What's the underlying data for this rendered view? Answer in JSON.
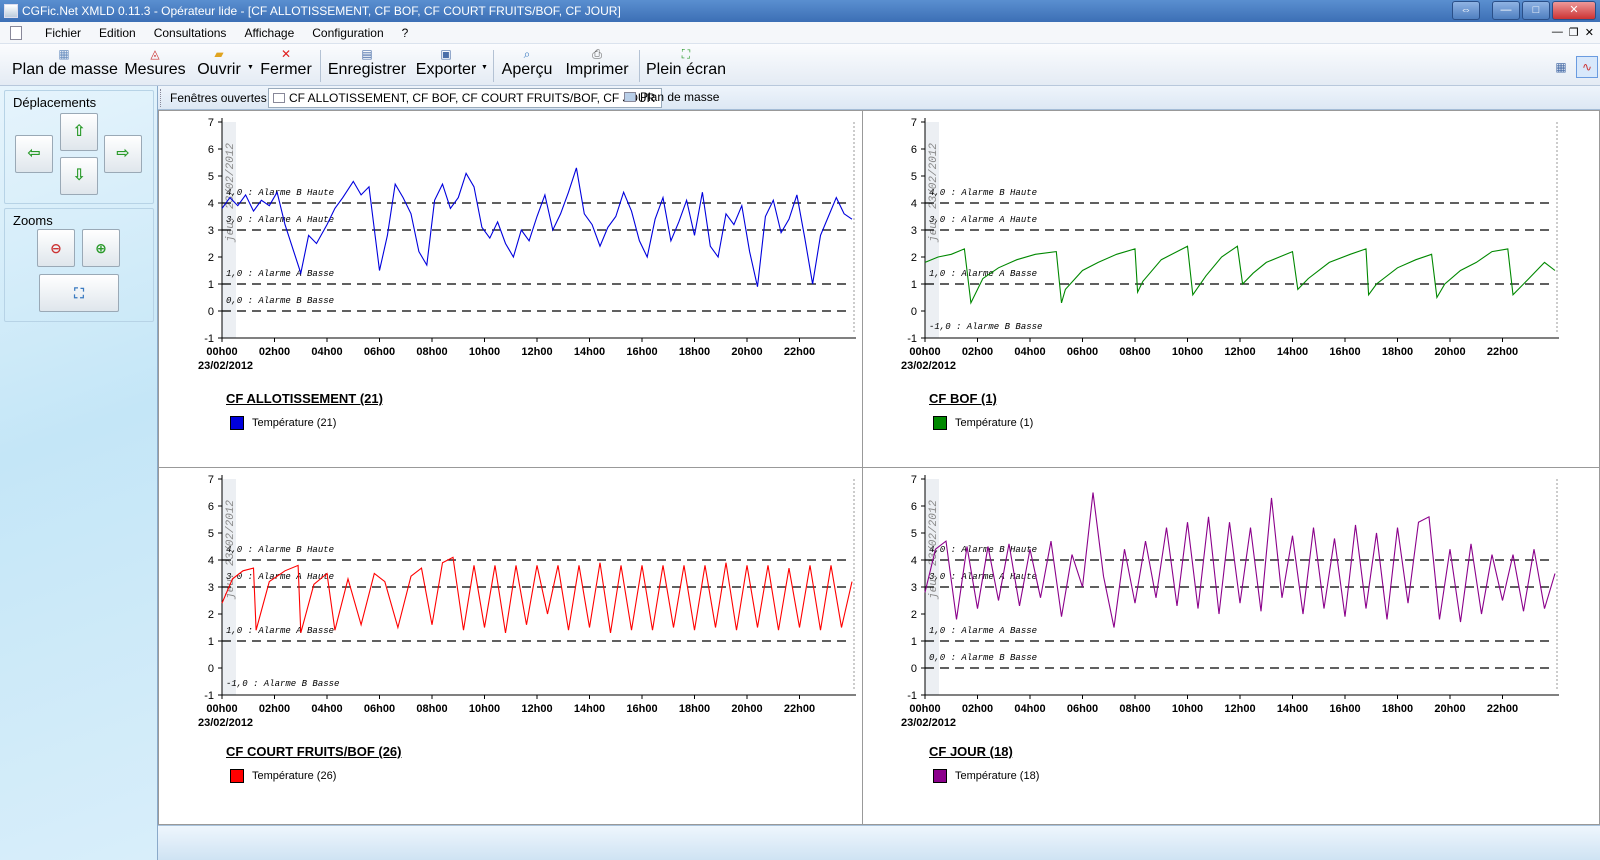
{
  "window": {
    "title": "CGFic.Net XMLD 0.11.3 - Opérateur lide - [CF ALLOTISSEMENT, CF BOF, CF COURT FRUITS/BOF, CF JOUR]",
    "buttons": [
      "⇔",
      "—",
      "□",
      "✕"
    ]
  },
  "menu": {
    "items": [
      "Fichier",
      "Edition",
      "Consultations",
      "Affichage",
      "Configuration",
      "?"
    ],
    "mdi_controls": [
      "—",
      "❐",
      "✕"
    ]
  },
  "toolbar": {
    "buttons": [
      {
        "label": "Plan de masse",
        "icon": "site-plan-icon"
      },
      {
        "label": "Mesures",
        "icon": "measures-chart-icon"
      },
      {
        "label": "Ouvrir",
        "icon": "folder-open-icon"
      },
      {
        "label": "Fermer",
        "icon": "close-x-icon"
      },
      {
        "label": "Enregistrer",
        "icon": "save-icon"
      },
      {
        "label": "Exporter",
        "icon": "export-icon"
      },
      {
        "label": "Aperçu",
        "icon": "preview-magnifier-icon"
      },
      {
        "label": "Imprimer",
        "icon": "printer-icon"
      },
      {
        "label": "Plein écran",
        "icon": "fullscreen-icon"
      }
    ],
    "dropdown_glyph": "▼",
    "right_buttons": [
      "table-view-icon",
      "chart-view-icon"
    ]
  },
  "left_panel": {
    "deplacements_title": "Déplacements",
    "zooms_title": "Zooms",
    "arrows": {
      "up": "⇧",
      "left": "⇦",
      "right": "⇨",
      "down": "⇩"
    },
    "zoom_buttons": [
      "zoom-out-icon",
      "zoom-in-icon",
      "zoom-fit-icon"
    ]
  },
  "tabs": {
    "label": "Fenêtres ouvertes :",
    "items": [
      {
        "label": "CF ALLOTISSEMENT, CF BOF, CF COURT FRUITS/BOF, CF JOUR",
        "active": true
      },
      {
        "label": "Plan de masse",
        "active": false
      }
    ]
  },
  "charts": {
    "y_ticks": [
      "7",
      "6",
      "5",
      "4",
      "3",
      "2",
      "1",
      "0",
      "-1"
    ],
    "x_ticks": [
      "00h00",
      "02h00",
      "04h00",
      "06h00",
      "08h00",
      "10h00",
      "12h00",
      "14h00",
      "16h00",
      "18h00",
      "20h00",
      "22h00"
    ],
    "date_label": "23/02/2012",
    "date_rotated": "jeu. 23/02/2012",
    "colors": {
      "axis": "#000000",
      "threshold": "#000000"
    }
  },
  "chart_data": [
    {
      "type": "line",
      "title": "CF ALLOTISSEMENT (21)",
      "xlabel": "",
      "ylabel": "",
      "ylim": [
        -1,
        7
      ],
      "xlim_hours": [
        0,
        24
      ],
      "thresholds": [
        {
          "value": 4.0,
          "label": "4,0 : Alarme B Haute"
        },
        {
          "value": 3.0,
          "label": "3,0 : Alarme A Haute"
        },
        {
          "value": 1.0,
          "label": "1,0 : Alarme A Basse"
        },
        {
          "value": 0.0,
          "label": "0,0 : Alarme B Basse"
        }
      ],
      "series": [
        {
          "name": "Température (21)",
          "color": "#0000dd",
          "x_hours": [
            0,
            0.3,
            0.6,
            0.9,
            1.2,
            1.5,
            1.8,
            2.1,
            2.4,
            2.7,
            3.0,
            3.3,
            3.6,
            4.0,
            4.3,
            4.6,
            5.0,
            5.3,
            5.6,
            6.0,
            6.3,
            6.6,
            6.9,
            7.2,
            7.5,
            7.8,
            8.1,
            8.4,
            8.7,
            9.0,
            9.3,
            9.6,
            9.9,
            10.2,
            10.5,
            10.8,
            11.1,
            11.4,
            11.7,
            12.0,
            12.3,
            12.6,
            12.9,
            13.2,
            13.5,
            13.8,
            14.1,
            14.4,
            14.7,
            15.0,
            15.3,
            15.6,
            15.9,
            16.2,
            16.5,
            16.8,
            17.1,
            17.4,
            17.7,
            18.0,
            18.3,
            18.6,
            18.9,
            19.2,
            19.5,
            19.8,
            20.1,
            20.4,
            20.7,
            21.0,
            21.3,
            21.6,
            21.9,
            22.2,
            22.5,
            22.8,
            23.1,
            23.4,
            23.7,
            24.0
          ],
          "values": [
            3.8,
            4.2,
            3.9,
            4.3,
            3.7,
            4.1,
            3.9,
            4.4,
            3.2,
            2.3,
            1.4,
            2.8,
            2.5,
            3.2,
            3.8,
            4.2,
            4.8,
            4.3,
            4.6,
            1.5,
            2.8,
            4.7,
            4.2,
            3.6,
            2.2,
            1.7,
            4.1,
            4.7,
            3.8,
            4.2,
            5.1,
            4.6,
            3.1,
            2.7,
            3.3,
            2.5,
            2.0,
            3.0,
            2.6,
            3.5,
            4.3,
            3.0,
            3.6,
            4.4,
            5.3,
            3.6,
            3.2,
            2.4,
            3.1,
            3.5,
            4.4,
            3.7,
            2.6,
            2.0,
            3.4,
            4.2,
            2.6,
            3.3,
            4.1,
            2.8,
            4.4,
            2.4,
            2.0,
            3.6,
            3.2,
            3.9,
            2.2,
            0.9,
            3.5,
            4.1,
            2.9,
            3.4,
            4.3,
            2.7,
            1.0,
            2.8,
            3.5,
            4.2,
            3.6,
            3.4
          ]
        }
      ]
    },
    {
      "type": "line",
      "title": "CF BOF (1)",
      "xlabel": "",
      "ylabel": "",
      "ylim": [
        -1,
        7
      ],
      "xlim_hours": [
        0,
        24
      ],
      "thresholds": [
        {
          "value": 4.0,
          "label": "4,0 : Alarme B Haute"
        },
        {
          "value": 3.0,
          "label": "3,0 : Alarme A Haute"
        },
        {
          "value": 1.0,
          "label": "1,0 : Alarme A Basse"
        },
        {
          "value": -1.0,
          "label": "-1,0 : Alarme B Basse"
        }
      ],
      "series": [
        {
          "name": "Température (1)",
          "color": "#008800",
          "x_hours": [
            0,
            0.5,
            1.0,
            1.5,
            1.75,
            2.2,
            2.8,
            3.5,
            4.2,
            5.0,
            5.2,
            5.35,
            6.0,
            6.6,
            7.3,
            8.0,
            8.1,
            8.3,
            9.0,
            9.6,
            10.0,
            10.2,
            10.7,
            11.3,
            11.9,
            12.1,
            12.5,
            13.0,
            13.5,
            14.0,
            14.2,
            14.6,
            15.4,
            16.2,
            16.8,
            16.9,
            17.2,
            18.0,
            18.7,
            19.3,
            19.5,
            19.8,
            20.4,
            21.0,
            21.6,
            22.2,
            22.4,
            23.0,
            23.6,
            24.0
          ],
          "values": [
            1.8,
            2.0,
            2.1,
            2.3,
            0.3,
            1.2,
            1.6,
            1.9,
            2.1,
            2.2,
            0.3,
            0.8,
            1.5,
            1.8,
            2.1,
            2.3,
            0.7,
            1.1,
            1.9,
            2.2,
            2.4,
            0.6,
            1.3,
            2.0,
            2.4,
            1.0,
            1.4,
            1.8,
            2.0,
            2.2,
            0.8,
            1.2,
            1.8,
            2.1,
            2.3,
            0.6,
            1.0,
            1.6,
            1.9,
            2.1,
            0.5,
            1.0,
            1.5,
            1.8,
            2.2,
            2.3,
            0.6,
            1.2,
            1.8,
            1.5
          ]
        }
      ]
    },
    {
      "type": "line",
      "title": "CF COURT FRUITS/BOF (26)",
      "xlabel": "",
      "ylabel": "",
      "ylim": [
        -1,
        7
      ],
      "xlim_hours": [
        0,
        24
      ],
      "thresholds": [
        {
          "value": 4.0,
          "label": "4,0 : Alarme B Haute"
        },
        {
          "value": 3.0,
          "label": "3,0 : Alarme A Haute"
        },
        {
          "value": 1.0,
          "label": "1,0 : Alarme A Basse"
        },
        {
          "value": -1.0,
          "label": "-1,0 : Alarme B Basse"
        }
      ],
      "series": [
        {
          "name": "Température (26)",
          "color": "#ff0000",
          "x_hours": [
            0,
            0.4,
            0.8,
            1.2,
            1.3,
            1.8,
            2.4,
            2.9,
            3.0,
            3.5,
            4.0,
            4.3,
            4.8,
            5.3,
            5.8,
            6.2,
            6.7,
            7.2,
            7.6,
            8.0,
            8.4,
            8.8,
            9.2,
            9.6,
            10.0,
            10.4,
            10.8,
            11.2,
            11.6,
            12.0,
            12.4,
            12.8,
            13.2,
            13.6,
            14.0,
            14.4,
            14.8,
            15.2,
            15.6,
            16.0,
            16.4,
            16.8,
            17.2,
            17.6,
            18.0,
            18.4,
            18.8,
            19.2,
            19.6,
            20.0,
            20.4,
            20.8,
            21.2,
            21.6,
            22.0,
            22.4,
            22.8,
            23.2,
            23.6,
            24.0
          ],
          "values": [
            2.4,
            3.3,
            3.6,
            3.7,
            1.4,
            3.2,
            3.6,
            3.8,
            1.3,
            3.1,
            3.5,
            1.4,
            3.3,
            1.6,
            3.5,
            3.2,
            1.5,
            3.4,
            3.7,
            1.6,
            3.9,
            4.1,
            1.4,
            3.8,
            1.5,
            3.8,
            1.3,
            3.8,
            1.6,
            3.8,
            2.0,
            3.8,
            1.4,
            3.8,
            1.5,
            3.9,
            1.3,
            3.8,
            1.4,
            3.8,
            1.4,
            3.8,
            1.5,
            3.8,
            1.4,
            3.8,
            1.5,
            3.9,
            1.4,
            3.8,
            1.5,
            3.8,
            1.4,
            3.7,
            1.5,
            3.8,
            1.4,
            3.8,
            1.5,
            3.2
          ]
        }
      ]
    },
    {
      "type": "line",
      "title": "CF JOUR (18)",
      "xlabel": "",
      "ylabel": "",
      "ylim": [
        -1,
        7
      ],
      "xlim_hours": [
        0,
        24
      ],
      "thresholds": [
        {
          "value": 4.0,
          "label": "4,0 : Alarme B Haute"
        },
        {
          "value": 3.0,
          "label": "3,0 : Alarme A Haute"
        },
        {
          "value": 1.0,
          "label": "1,0 : Alarme A Basse"
        },
        {
          "value": 0.0,
          "label": "0,0 : Alarme B Basse"
        }
      ],
      "series": [
        {
          "name": "Température (18)",
          "color": "#8b008b",
          "x_hours": [
            0,
            0.4,
            0.8,
            1.2,
            1.6,
            2.0,
            2.4,
            2.8,
            3.2,
            3.6,
            4.0,
            4.4,
            4.8,
            5.2,
            5.6,
            6.0,
            6.4,
            6.8,
            7.2,
            7.6,
            8.0,
            8.4,
            8.8,
            9.2,
            9.6,
            10.0,
            10.4,
            10.8,
            11.2,
            11.6,
            12.0,
            12.4,
            12.8,
            13.2,
            13.6,
            14.0,
            14.4,
            14.8,
            15.2,
            15.6,
            16.0,
            16.4,
            16.8,
            17.2,
            17.6,
            18.0,
            18.4,
            18.8,
            19.2,
            19.6,
            20.0,
            20.4,
            20.8,
            21.2,
            21.6,
            22.0,
            22.4,
            22.8,
            23.2,
            23.6,
            24.0
          ],
          "values": [
            2.8,
            4.4,
            4.7,
            1.8,
            4.5,
            2.2,
            4.5,
            2.5,
            4.6,
            2.3,
            4.4,
            2.6,
            4.7,
            1.9,
            4.2,
            3.0,
            6.5,
            3.4,
            1.5,
            4.4,
            2.4,
            4.7,
            2.6,
            5.2,
            2.3,
            5.4,
            2.2,
            5.6,
            2.0,
            5.4,
            2.4,
            5.2,
            2.1,
            6.3,
            2.6,
            4.9,
            2.0,
            5.2,
            2.2,
            4.8,
            1.9,
            5.3,
            2.2,
            5.0,
            1.8,
            5.2,
            2.4,
            5.4,
            5.6,
            1.8,
            4.4,
            1.7,
            4.6,
            2.0,
            4.2,
            2.5,
            4.2,
            2.1,
            4.4,
            2.2,
            3.5
          ]
        }
      ]
    }
  ],
  "status": {}
}
